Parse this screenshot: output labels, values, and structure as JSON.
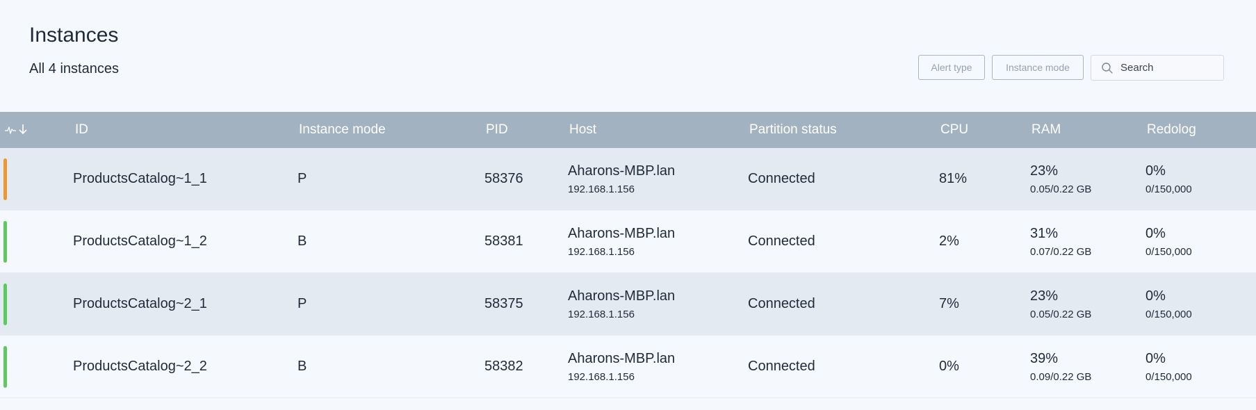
{
  "page": {
    "title": "Instances",
    "subtitle": "All 4 instances"
  },
  "filters": {
    "alert_type_label": "Alert type",
    "instance_mode_label": "Instance mode",
    "search_placeholder": "Search"
  },
  "table": {
    "columns": {
      "id": "ID",
      "mode": "Instance mode",
      "pid": "PID",
      "host": "Host",
      "partition": "Partition status",
      "cpu": "CPU",
      "ram": "RAM",
      "redolog": "Redolog"
    },
    "sort_icons": [
      "pulse-icon",
      "arrow-down-icon"
    ],
    "rows": [
      {
        "status_color": "#f0962e",
        "id": "ProductsCatalog~1_1",
        "mode": "P",
        "pid": "58376",
        "host": "Aharons-MBP.lan",
        "ip": "192.168.1.156",
        "partition": "Connected",
        "cpu": "81%",
        "ram_pct": "23%",
        "ram_detail": "0.05/0.22 GB",
        "redo_pct": "0%",
        "redo_detail": "0/150,000"
      },
      {
        "status_color": "#5ec95e",
        "id": "ProductsCatalog~1_2",
        "mode": "B",
        "pid": "58381",
        "host": "Aharons-MBP.lan",
        "ip": "192.168.1.156",
        "partition": "Connected",
        "cpu": "2%",
        "ram_pct": "31%",
        "ram_detail": "0.07/0.22 GB",
        "redo_pct": "0%",
        "redo_detail": "0/150,000"
      },
      {
        "status_color": "#5ec95e",
        "id": "ProductsCatalog~2_1",
        "mode": "P",
        "pid": "58375",
        "host": "Aharons-MBP.lan",
        "ip": "192.168.1.156",
        "partition": "Connected",
        "cpu": "7%",
        "ram_pct": "23%",
        "ram_detail": "0.05/0.22 GB",
        "redo_pct": "0%",
        "redo_detail": "0/150,000"
      },
      {
        "status_color": "#5ec95e",
        "id": "ProductsCatalog~2_2",
        "mode": "B",
        "pid": "58382",
        "host": "Aharons-MBP.lan",
        "ip": "192.168.1.156",
        "partition": "Connected",
        "cpu": "0%",
        "ram_pct": "39%",
        "ram_detail": "0.09/0.22 GB",
        "redo_pct": "0%",
        "redo_detail": "0/150,000"
      }
    ]
  }
}
